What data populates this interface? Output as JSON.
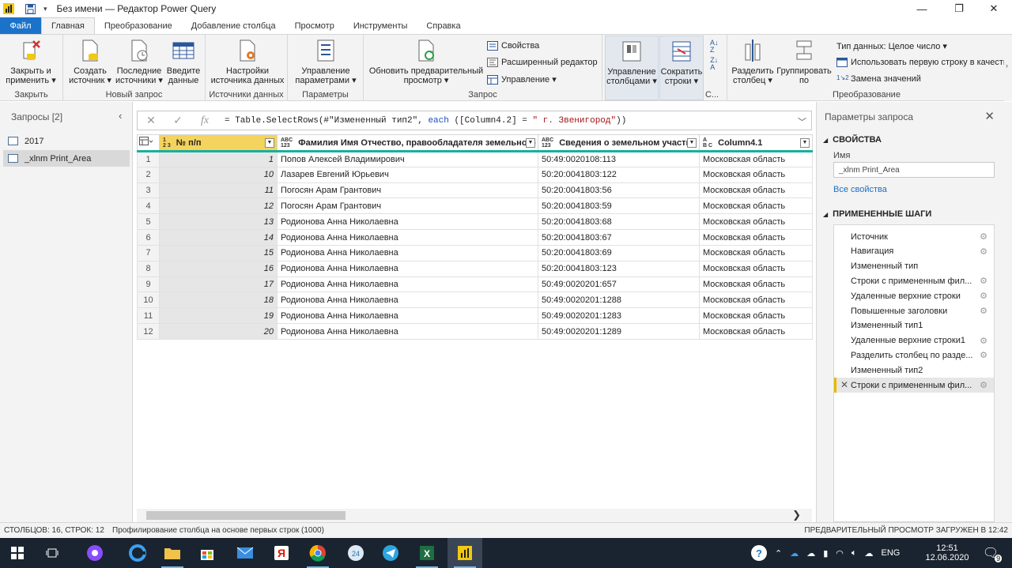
{
  "window": {
    "title": "Без имени — Редактор Power Query"
  },
  "tabs": [
    {
      "label": "Файл"
    },
    {
      "label": "Главная"
    },
    {
      "label": "Преобразование"
    },
    {
      "label": "Добавление столбца"
    },
    {
      "label": "Просмотр"
    },
    {
      "label": "Инструменты"
    },
    {
      "label": "Справка"
    }
  ],
  "ribbon": {
    "close": {
      "btn1": "Закрыть и",
      "btn2": "применить",
      "group": "Закрыть"
    },
    "newquery": {
      "create1": "Создать",
      "create2": "источник",
      "recent1": "Последние",
      "recent2": "источники",
      "enter1": "Введите",
      "enter2": "данные",
      "group": "Новый запрос"
    },
    "sources": {
      "btn1": "Настройки",
      "btn2": "источника данных",
      "group": "Источники данных"
    },
    "params": {
      "btn1": "Управление",
      "btn2": "параметрами",
      "group": "Параметры"
    },
    "query": {
      "refresh1": "Обновить предварительный",
      "refresh2": "просмотр",
      "properties": "Свойства",
      "advanced": "Расширенный редактор",
      "manage": "Управление",
      "group": "Запрос"
    },
    "columns": {
      "manage1": "Управление",
      "manage2": "столбцами",
      "reduce1": "Сократить",
      "reduce2": "строки",
      "group": "С..."
    },
    "transform": {
      "split1": "Разделить",
      "split2": "столбец",
      "group1": "Группировать",
      "group2": "по",
      "datatype": "Тип данных: Целое число",
      "firstrow": "Использовать первую строку в качестве",
      "replace": "Замена значений",
      "group": "Преобразование"
    }
  },
  "queries": {
    "header": "Запросы [2]",
    "items": [
      {
        "label": "2017"
      },
      {
        "label": "_xlnm Print_Area"
      }
    ]
  },
  "formula": {
    "prefix": "= Table.SelectRows(#\"Измененный тип2\", ",
    "kw": "each",
    "mid": " ([Column4.2] = ",
    "str": "\" г. Звенигород\"",
    "suffix": "))"
  },
  "grid": {
    "columns": [
      {
        "type_top": "1",
        "type_bot": "2 3",
        "label": "№ п/п"
      },
      {
        "type_top": "ABC",
        "type_bot": "123",
        "label": "Фамилия Имя Отчество, правообладателя земельного у..."
      },
      {
        "type_top": "ABC",
        "type_bot": "123",
        "label": "Сведения о земельном участке"
      },
      {
        "type_top": "A",
        "type_bot": "B C",
        "label": "Column4.1"
      }
    ],
    "rows": [
      {
        "n": "1",
        "id": "1",
        "name": "Попов Алексей Владимирович",
        "cad": "50:49:0020108:113",
        "region": "Московская область"
      },
      {
        "n": "2",
        "id": "10",
        "name": "Лазарев Евгений Юрьевич",
        "cad": "50:20:0041803:122",
        "region": "Московская область"
      },
      {
        "n": "3",
        "id": "11",
        "name": "Погосян Арам Грантович",
        "cad": "50:20:0041803:56",
        "region": "Московская область"
      },
      {
        "n": "4",
        "id": "12",
        "name": "Погосян Арам Грантович",
        "cad": "50:20:0041803:59",
        "region": "Московская область"
      },
      {
        "n": "5",
        "id": "13",
        "name": "Родионова Анна Николаевна",
        "cad": "50:20:0041803:68",
        "region": "Московская область"
      },
      {
        "n": "6",
        "id": "14",
        "name": "Родионова Анна Николаевна",
        "cad": "50:20:0041803:67",
        "region": "Московская область"
      },
      {
        "n": "7",
        "id": "15",
        "name": "Родионова Анна Николаевна",
        "cad": "50:20:0041803:69",
        "region": "Московская область"
      },
      {
        "n": "8",
        "id": "16",
        "name": "Родионова Анна Николаевна",
        "cad": "50:20:0041803:123",
        "region": "Московская область"
      },
      {
        "n": "9",
        "id": "17",
        "name": "Родионова Анна Николаевна",
        "cad": "50:49:0020201:657",
        "region": "Московская область"
      },
      {
        "n": "10",
        "id": "18",
        "name": "Родионова Анна Николаевна",
        "cad": "50:49:0020201:1288",
        "region": "Московская область"
      },
      {
        "n": "11",
        "id": "19",
        "name": "Родионова Анна Николаевна",
        "cad": "50:49:0020201:1283",
        "region": "Московская область"
      },
      {
        "n": "12",
        "id": "20",
        "name": "Родионова Анна Николаевна",
        "cad": "50:49:0020201:1289",
        "region": "Московская область"
      }
    ]
  },
  "settings": {
    "title": "Параметры запроса",
    "props_header": "СВОЙСТВА",
    "name_label": "Имя",
    "name_value": "_xlnm Print_Area",
    "all_props": "Все свойства",
    "steps_header": "ПРИМЕНЕННЫЕ ШАГИ",
    "steps": [
      {
        "label": "Источник",
        "gear": true
      },
      {
        "label": "Навигация",
        "gear": true
      },
      {
        "label": "Измененный тип",
        "gear": false
      },
      {
        "label": "Строки с примененным фил...",
        "gear": true
      },
      {
        "label": "Удаленные верхние строки",
        "gear": true
      },
      {
        "label": "Повышенные заголовки",
        "gear": true
      },
      {
        "label": "Измененный тип1",
        "gear": false
      },
      {
        "label": "Удаленные верхние строки1",
        "gear": true
      },
      {
        "label": "Разделить столбец по разде...",
        "gear": true
      },
      {
        "label": "Измененный тип2",
        "gear": false
      },
      {
        "label": "Строки с примененным фил...",
        "gear": true
      }
    ]
  },
  "status": {
    "left": "СТОЛБЦОВ: 16, СТРОК: 12",
    "mid": "Профилирование столбца на основе первых строк (1000)",
    "right": "ПРЕДВАРИТЕЛЬНЫЙ ПРОСМОТР ЗАГРУЖЕН В 12:42"
  },
  "taskbar": {
    "lang": "ENG",
    "time": "12:51",
    "date": "12.06.2020",
    "notif": "9"
  },
  "colors": {
    "accent": "#1b73c9",
    "selected_col": "#f4d35e",
    "quality_bar": "#17b0a0"
  }
}
